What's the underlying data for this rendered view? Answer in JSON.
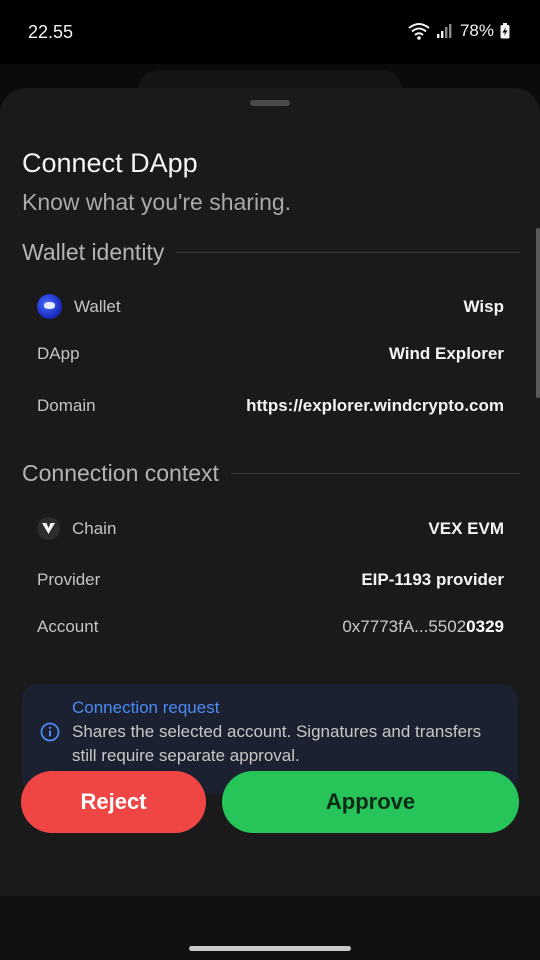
{
  "status_bar": {
    "time": "22.55",
    "battery": "78%"
  },
  "sheet": {
    "title": "Connect DApp",
    "subtitle": "Know what you're sharing."
  },
  "wallet_identity": {
    "heading": "Wallet identity",
    "rows": [
      {
        "label": "Wallet",
        "value": "Wisp",
        "icon": "wisp-wallet-icon"
      },
      {
        "label": "DApp",
        "value": "Wind Explorer"
      },
      {
        "label": "Domain",
        "value": "https://explorer.windcrypto.com"
      }
    ]
  },
  "connection_context": {
    "heading": "Connection context",
    "rows": [
      {
        "label": "Chain",
        "value": "VEX EVM",
        "icon": "vex-chain-icon"
      },
      {
        "label": "Provider",
        "value": "EIP-1193 provider"
      },
      {
        "label": "Account",
        "value_prefix": "0x7773fA...5502",
        "value_suffix": "0329"
      }
    ]
  },
  "info": {
    "title": "Connection request",
    "body": "Shares the selected account. Signatures and transfers still require separate approval."
  },
  "actions": {
    "reject": "Reject",
    "approve": "Approve"
  },
  "colors": {
    "reject": "#f04545",
    "approve": "#27c45a",
    "info_accent": "#4c8bf5",
    "sheet_bg": "#1a1a1a"
  }
}
